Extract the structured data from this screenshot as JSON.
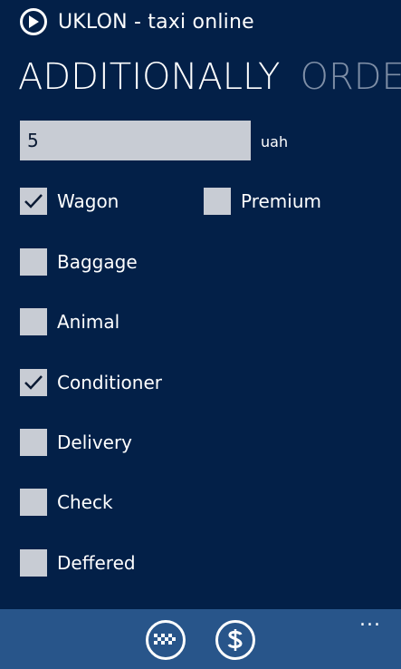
{
  "header": {
    "title": "UKLON - taxi online",
    "logo_icon": "play-circle-icon"
  },
  "pivot": {
    "active": "ADDITIONALLY",
    "next": "ORDE"
  },
  "amount": {
    "value": "5",
    "unit": "uah"
  },
  "options": {
    "wagon": {
      "label": "Wagon",
      "checked": true
    },
    "premium": {
      "label": "Premium",
      "checked": false
    },
    "baggage": {
      "label": "Baggage",
      "checked": false
    },
    "animal": {
      "label": "Animal",
      "checked": false
    },
    "conditioner": {
      "label": "Conditioner",
      "checked": true
    },
    "delivery": {
      "label": "Delivery",
      "checked": false
    },
    "check": {
      "label": "Check",
      "checked": false
    },
    "deffered": {
      "label": "Deffered",
      "checked": false
    }
  },
  "appbar": {
    "buttons": [
      "taxi-icon",
      "dollar-icon"
    ],
    "more": "..."
  },
  "colors": {
    "background": "#032048",
    "appbar": "#28558a",
    "checkbox": "#c8ccd4",
    "pivot_inactive": "#7e8ea6"
  }
}
